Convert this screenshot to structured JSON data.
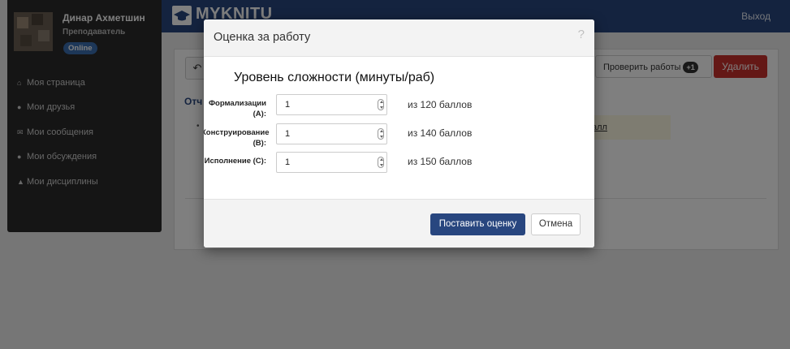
{
  "app": {
    "logo_text": "MYKNITU",
    "logout": "Выход"
  },
  "user": {
    "name": "Динар Ахметшин",
    "role": "Преподаватель",
    "status": "Online"
  },
  "sidebar": {
    "items": [
      {
        "label": "Моя страница",
        "icon": "home-icon"
      },
      {
        "label": "Мои друзья",
        "icon": "user-icon"
      },
      {
        "label": "Мои сообщения",
        "icon": "envelope-icon"
      },
      {
        "label": "Мои обсуждения",
        "icon": "comments-icon"
      },
      {
        "label": "Мои дисциплины",
        "icon": "graduation-cap-icon"
      }
    ]
  },
  "toolbar": {
    "check_label": "Проверить работы",
    "check_badge": "+1",
    "delete_label": "Удалить"
  },
  "content": {
    "section_label": "Отч",
    "link_text": "алл"
  },
  "modal": {
    "title": "Оценка за работу",
    "help": "?",
    "subtitle": "Уровень сложности (минуты/раб)",
    "rows": [
      {
        "label": "Формализации (А):",
        "value": "1",
        "max": "из 120 баллов"
      },
      {
        "label": "Конструирование (В):",
        "value": "1",
        "max": "из 140 баллов"
      },
      {
        "label": "Исполнение (С):",
        "value": "1",
        "max": "из 150 баллов"
      }
    ],
    "submit_label": "Поставить оценку",
    "cancel_label": "Отмена"
  },
  "colors": {
    "brand": "#28467f",
    "danger": "#c9302c",
    "sidebar": "#2b2b2b",
    "online": "#3a6fb1"
  }
}
